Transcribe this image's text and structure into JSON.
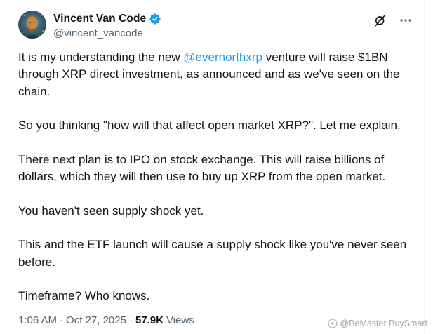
{
  "author": {
    "display_name": "Vincent Van Code",
    "handle": "@vincent_vancode"
  },
  "tweet": {
    "part1": "It is my understanding the new ",
    "mention": "@evernorthxrp",
    "part2": " venture will raise $1BN through XRP direct investment, as announced and as we've seen on the chain.\n\nSo you thinking \"how will that affect open market XRP?\". Let me explain.\n\nThere next plan is to IPO on stock exchange. This will raise billions of dollars, which they will then use to buy up XRP from the open market.\n\nYou haven't seen supply shock yet.\n\nThis and the ETF launch will cause a supply shock like you've never seen before.\n\nTimeframe? Who knows."
  },
  "meta": {
    "time": "1:06 AM",
    "separator1": "·",
    "date": "Oct 27, 2025",
    "separator2": "·",
    "views_count": "57.9K",
    "views_label": "Views"
  },
  "watermark": {
    "text": "@BeMaster BuySmart"
  },
  "icons": {
    "verified": "verified-badge-icon",
    "grok": "grok-icon",
    "more": "more-options-icon"
  },
  "colors": {
    "accent": "#1d9bf0",
    "text": "#0f1419",
    "secondary": "#536471"
  }
}
